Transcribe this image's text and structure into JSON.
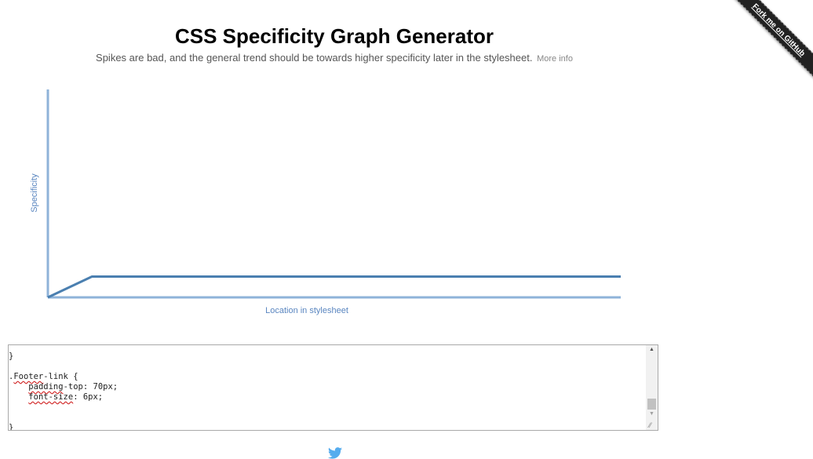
{
  "header": {
    "title": "CSS Specificity Graph Generator",
    "subtitle": "Spikes are bad, and the general trend should be towards higher specificity later in the stylesheet.",
    "more_info_label": "More info"
  },
  "chart_data": {
    "type": "line",
    "ylabel": "Specificity",
    "xlabel": "Location in stylesheet",
    "x": [
      0,
      1,
      13
    ],
    "series": [
      {
        "values": [
          0,
          10,
          10
        ]
      }
    ],
    "xlim": [
      0,
      13
    ],
    "ylim": [
      0,
      100
    ],
    "grid": false
  },
  "editor": {
    "lines": [
      "}",
      "",
      ".Footer-link {",
      "    padding-top: 70px;",
      "    font-size: 6px;",
      "",
      "",
      "}"
    ],
    "scroll_up_glyph": "▲",
    "scroll_down_glyph": "▼",
    "resize_glyph": "⁄⁄"
  },
  "ribbon": {
    "label": "Fork me on GitHub"
  },
  "colors": {
    "axis": "#8fb3d9",
    "line": "#4a7fb0",
    "label": "#5a86c0",
    "twitter": "#55acee"
  },
  "icons": {
    "twitter": "twitter-bird-icon"
  }
}
